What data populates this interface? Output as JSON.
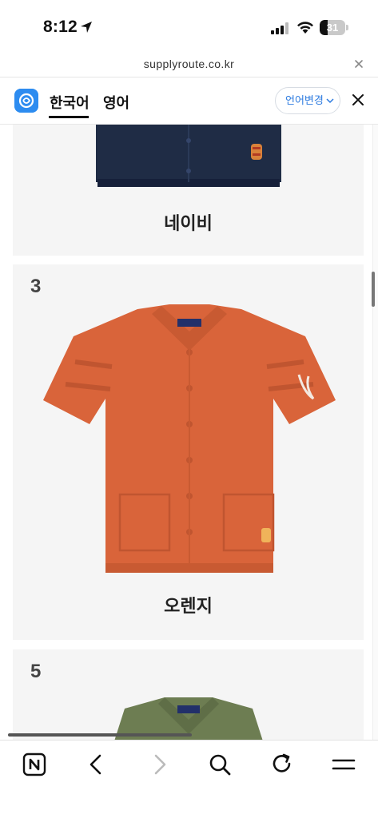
{
  "status_bar": {
    "time": "8:12",
    "battery_level": "31",
    "battery_fraction": 0.31
  },
  "browser": {
    "url": "supplyroute.co.kr"
  },
  "translate_bar": {
    "tabs": [
      {
        "label": "한국어",
        "active": true
      },
      {
        "label": "영어",
        "active": false
      }
    ],
    "change_language_label": "언어변경"
  },
  "products": [
    {
      "number": "",
      "color_label": "네이비",
      "swatch": "#1f2c45"
    },
    {
      "number": "3",
      "color_label": "오렌지",
      "swatch": "#d9643a"
    },
    {
      "number": "5",
      "color_label": "",
      "swatch": "#6d7d52"
    }
  ],
  "toolbar": {
    "icons": [
      "naver-n-icon",
      "back-icon",
      "forward-icon",
      "search-icon",
      "reload-icon",
      "menu-icon"
    ]
  },
  "colors": {
    "accent": "#2d7be0",
    "card_bg": "#f5f5f5"
  }
}
